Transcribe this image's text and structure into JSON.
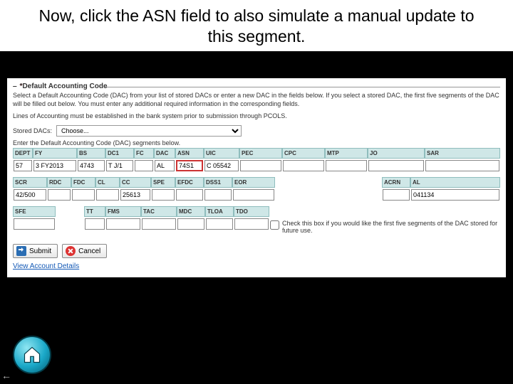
{
  "instruction": "Now, click the ASN field to also simulate a manual update to this segment.",
  "fieldset": {
    "title": "*Default Accounting Code",
    "help1": "Select a Default Accounting Code (DAC) from your list of stored DACs or enter a new DAC in the fields below. If you select a stored DAC, the first five segments of the DAC will be filled out below. You must enter any additional required information in the corresponding fields.",
    "help2": "Lines of Accounting must be established in the bank system prior to submission through PCOLS.",
    "stored_label": "Stored DACs:",
    "stored_value": "Choose...",
    "seg_instr": "Enter the Default Accounting Code (DAC) segments below.",
    "checkbox_label": "Check this box if you would like the first five segments of the DAC stored for future use."
  },
  "row1": {
    "headers": [
      "DEPT",
      "FY",
      "BS",
      "DC1",
      "FC",
      "DAC",
      "ASN",
      "UIC",
      "PEC",
      "CPC",
      "MTP",
      "JO",
      "SAR"
    ],
    "values": [
      "57",
      "3 FY2013",
      "4743",
      "T J/1",
      "",
      "AL",
      "74S1",
      "C 05542",
      "",
      "",
      "",
      "",
      ""
    ]
  },
  "row2": {
    "headers": [
      "SCR",
      "RDC",
      "FDC",
      "CL",
      "CC",
      "SPE",
      "EFDC",
      "DSS1",
      "EOR",
      "",
      "ACRN",
      "AL"
    ],
    "values": [
      "42/500",
      "",
      "",
      "",
      "25613",
      "",
      "",
      "",
      "",
      "",
      "",
      "041134"
    ]
  },
  "row3": {
    "headers": [
      "SFE",
      "",
      "TT",
      "FMS",
      "TAC",
      "MDC",
      "TLOA",
      "TDO"
    ],
    "values": [
      "",
      "",
      "",
      "",
      "",
      "",
      "",
      ""
    ]
  },
  "buttons": {
    "submit": "Submit",
    "cancel": "Cancel"
  },
  "link": "View Account Details"
}
